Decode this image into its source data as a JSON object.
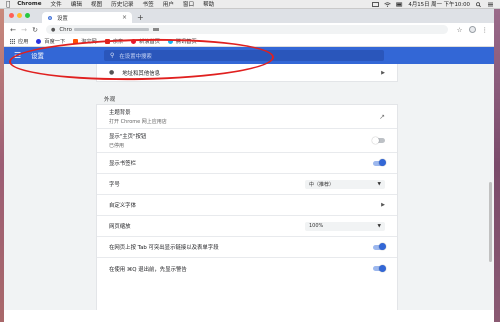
{
  "menubar": {
    "app": "Chrome",
    "items": [
      "文件",
      "编辑",
      "视图",
      "历史记录",
      "书签",
      "用户",
      "窗口",
      "帮助"
    ],
    "datetime": "4月15日 周一 下午10:00"
  },
  "tab": {
    "title": "设置",
    "close": "×",
    "new_tab": "+"
  },
  "address": {
    "prefix": "Chro"
  },
  "bookmarks": [
    {
      "label": "应用",
      "color": "#5f6368"
    },
    {
      "label": "百度一下",
      "color": "#2932e1"
    },
    {
      "label": "淘宝网",
      "color": "#ff5000"
    },
    {
      "label": "京东",
      "color": "#e1251b"
    },
    {
      "label": "新浪首页",
      "color": "#e6162d"
    },
    {
      "label": "腾讯首页",
      "color": "#12b7f5"
    }
  ],
  "settings": {
    "title": "设置",
    "search_placeholder": "在设置中搜索",
    "address_row": "地址和其他信息",
    "section": "外观",
    "rows": {
      "theme_title": "主题背景",
      "theme_sub": "打开 Chrome 网上应用店",
      "home_title": "显示\"主页\"按钮",
      "home_sub": "已停用",
      "bookmarks_bar": "显示书签栏",
      "font_size": "字号",
      "font_size_value": "中（推荐）",
      "custom_fonts": "自定义字体",
      "zoom": "网页缩放",
      "zoom_value": "100%",
      "tab_highlight": "在网页上按 Tab 可突出显示链接以及表单字段",
      "warn_quit": "在使用 ⌘Q 退出前，先显示警告"
    }
  },
  "colors": {
    "accent": "#3367d6",
    "annotation": "#e0201f"
  }
}
